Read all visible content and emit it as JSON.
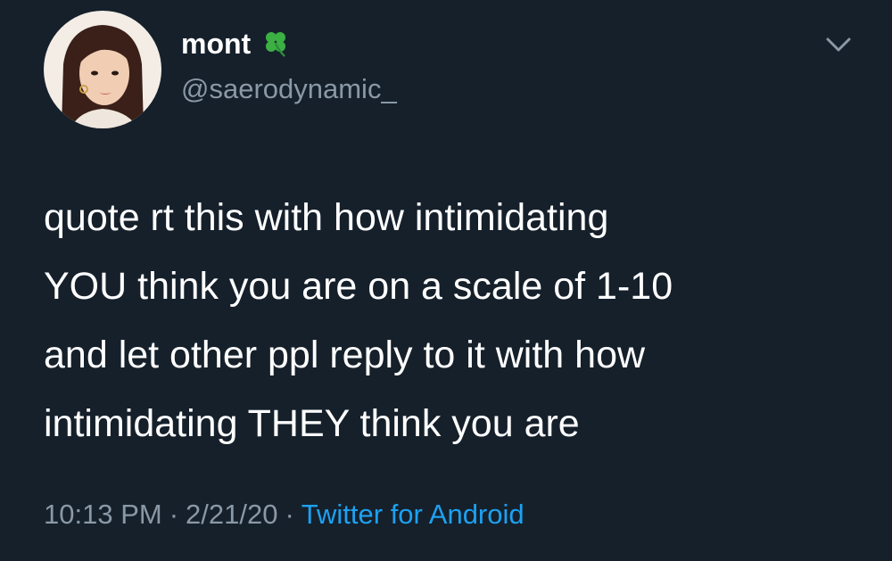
{
  "tweet": {
    "author": {
      "display_name": "mont",
      "handle": "@saerodynamic_",
      "badge_icon": "four-leaf-clover-icon",
      "avatar_icon": "profile-photo"
    },
    "text_lines": [
      "quote rt this with how intimidating",
      "YOU think you are on a scale of 1-10",
      "and let other ppl reply to it with how",
      "intimidating THEY think you are"
    ],
    "time": "10:13 PM",
    "date": "2/21/20",
    "separator": "·",
    "source": "Twitter for Android",
    "menu_icon": "chevron-down-icon"
  },
  "colors": {
    "background": "#15202b",
    "text": "#ffffff",
    "secondary_text": "#8b98a5",
    "link": "#1da1f2",
    "clover": "#3cb043"
  }
}
